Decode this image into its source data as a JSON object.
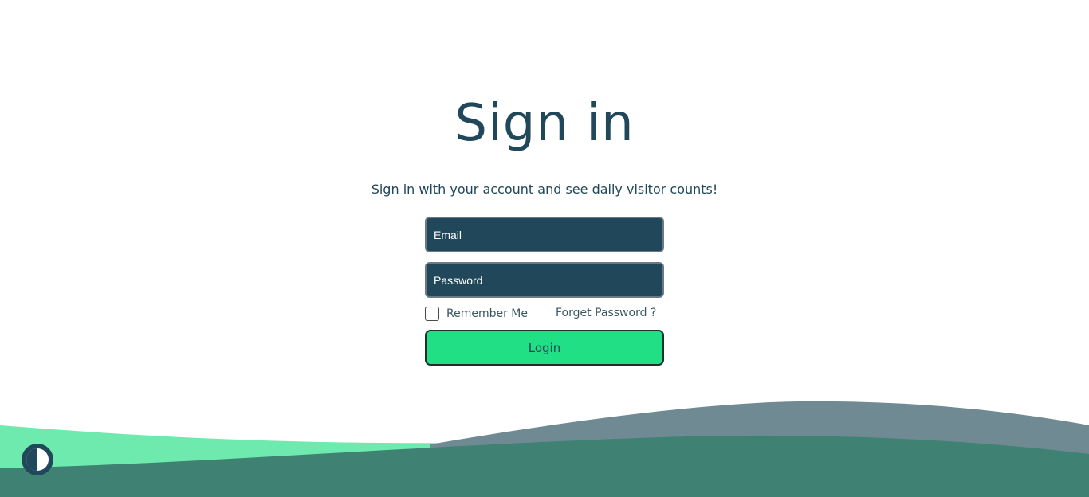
{
  "page": {
    "title": "Sign in",
    "subtitle": "Sign in with your account and see daily visitor counts!"
  },
  "form": {
    "email_placeholder": "Email",
    "password_placeholder": "Password",
    "remember_label": "Remember Me",
    "forgot_label": "Forget Password ?",
    "login_label": "Login"
  },
  "icons": {
    "theme_toggle": "contrast-icon"
  },
  "colors": {
    "primary_dark": "#21485a",
    "accent_green": "#20df84",
    "wave_light_green": "#6eeaae",
    "wave_slate": "#708a93",
    "wave_teal": "#3f8173"
  }
}
